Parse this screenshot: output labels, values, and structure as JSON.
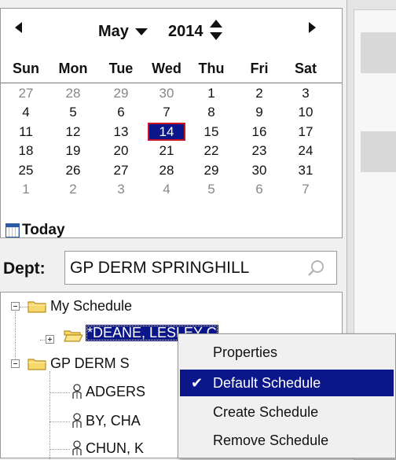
{
  "calendar": {
    "month": "May",
    "year": "2014",
    "weekdays": [
      "Sun",
      "Mon",
      "Tue",
      "Wed",
      "Thu",
      "Fri",
      "Sat"
    ],
    "weeks": [
      [
        "27",
        "28",
        "29",
        "30",
        "1",
        "2",
        "3"
      ],
      [
        "4",
        "5",
        "6",
        "7",
        "8",
        "9",
        "10"
      ],
      [
        "11",
        "12",
        "13",
        "14",
        "15",
        "16",
        "17"
      ],
      [
        "18",
        "19",
        "20",
        "21",
        "22",
        "23",
        "24"
      ],
      [
        "25",
        "26",
        "27",
        "28",
        "29",
        "30",
        "31"
      ],
      [
        "1",
        "2",
        "3",
        "4",
        "5",
        "6",
        "7"
      ]
    ],
    "selected_day": "14",
    "today_label": "Today"
  },
  "dept": {
    "label": "Dept:",
    "value": "GP DERM SPRINGHILL"
  },
  "tree": {
    "my_schedule": "My Schedule",
    "selected_node": "*DEANE, LESLEY C",
    "dept_node": "GP DERM S",
    "people": [
      "ADGERS",
      "BY, CHA",
      "CHUN, K"
    ]
  },
  "context_menu": {
    "items": [
      {
        "label": "Properties",
        "checked": false,
        "highlighted": false
      },
      {
        "label": "Default Schedule",
        "checked": true,
        "highlighted": true
      },
      {
        "label": "Create Schedule",
        "checked": false,
        "highlighted": false
      },
      {
        "label": "Remove Schedule",
        "checked": false,
        "highlighted": false
      }
    ]
  },
  "colors": {
    "selection": "#0b168a",
    "selection_border": "#c81425",
    "folder_fill": "#f7d86a",
    "folder_stroke": "#b8901e"
  }
}
